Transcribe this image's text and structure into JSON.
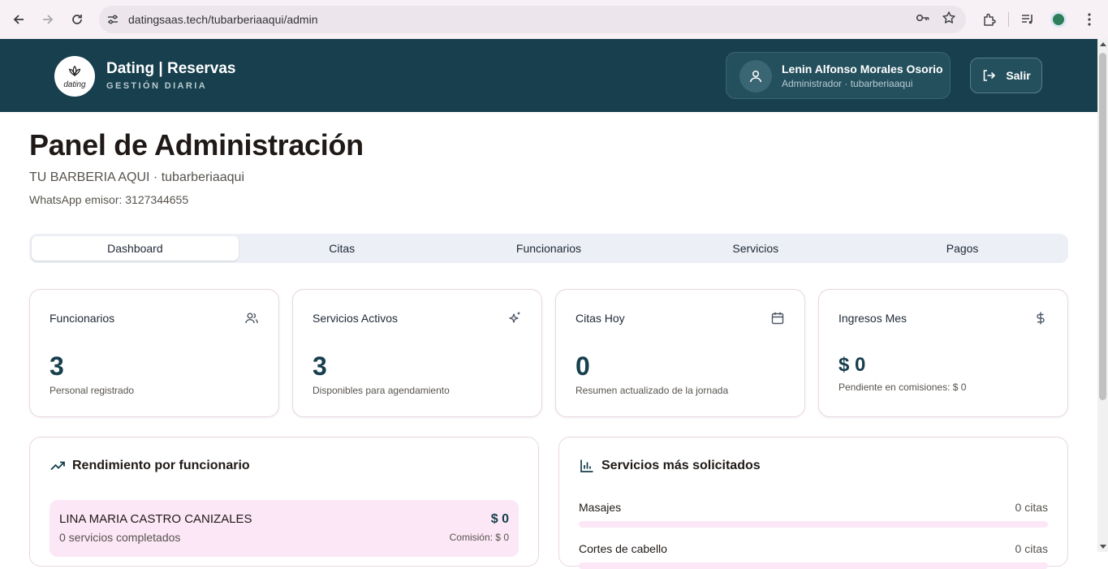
{
  "browser": {
    "url": "datingsaas.tech/tubarberiaaqui/admin"
  },
  "header": {
    "brand_title": "Dating | Reservas",
    "brand_subtitle": "GESTIÓN DIARIA",
    "logo_word": "dating",
    "user_name": "Lenin Alfonso Morales Osorio",
    "user_role": "Administrador · tubarberiaaqui",
    "logout_label": "Salir"
  },
  "page": {
    "title": "Panel de Administración",
    "subtitle": "TU BARBERIA AQUI · tubarberiaaqui",
    "whatsapp": "WhatsApp emisor: 3127344655"
  },
  "tabs": [
    {
      "label": "Dashboard",
      "active": true
    },
    {
      "label": "Citas",
      "active": false
    },
    {
      "label": "Funcionarios",
      "active": false
    },
    {
      "label": "Servicios",
      "active": false
    },
    {
      "label": "Pagos",
      "active": false
    }
  ],
  "stats": [
    {
      "label": "Funcionarios",
      "value": "3",
      "foot": "Personal registrado",
      "icon": "users-icon"
    },
    {
      "label": "Servicios Activos",
      "value": "3",
      "foot": "Disponibles para agendamiento",
      "icon": "sparkles-icon"
    },
    {
      "label": "Citas Hoy",
      "value": "0",
      "foot": "Resumen actualizado de la jornada",
      "icon": "calendar-icon"
    },
    {
      "label": "Ingresos Mes",
      "value": "$ 0",
      "foot": "Pendiente en comisiones: $ 0",
      "icon": "dollar-icon"
    }
  ],
  "performance": {
    "title": "Rendimiento por funcionario",
    "employees": [
      {
        "name": "LINA MARIA CASTRO CANIZALES",
        "completed": "0 servicios completados",
        "amount": "$ 0",
        "commission": "Comisión: $ 0"
      }
    ]
  },
  "top_services": {
    "title": "Servicios más solicitados",
    "items": [
      {
        "name": "Masajes",
        "count": "0 citas",
        "fraction": 0
      },
      {
        "name": "Cortes de cabello",
        "count": "0 citas",
        "fraction": 0
      }
    ]
  },
  "colors": {
    "primary": "#173f4d",
    "accent_pink": "#fce7f6",
    "border_pink": "#e8d6e3"
  }
}
